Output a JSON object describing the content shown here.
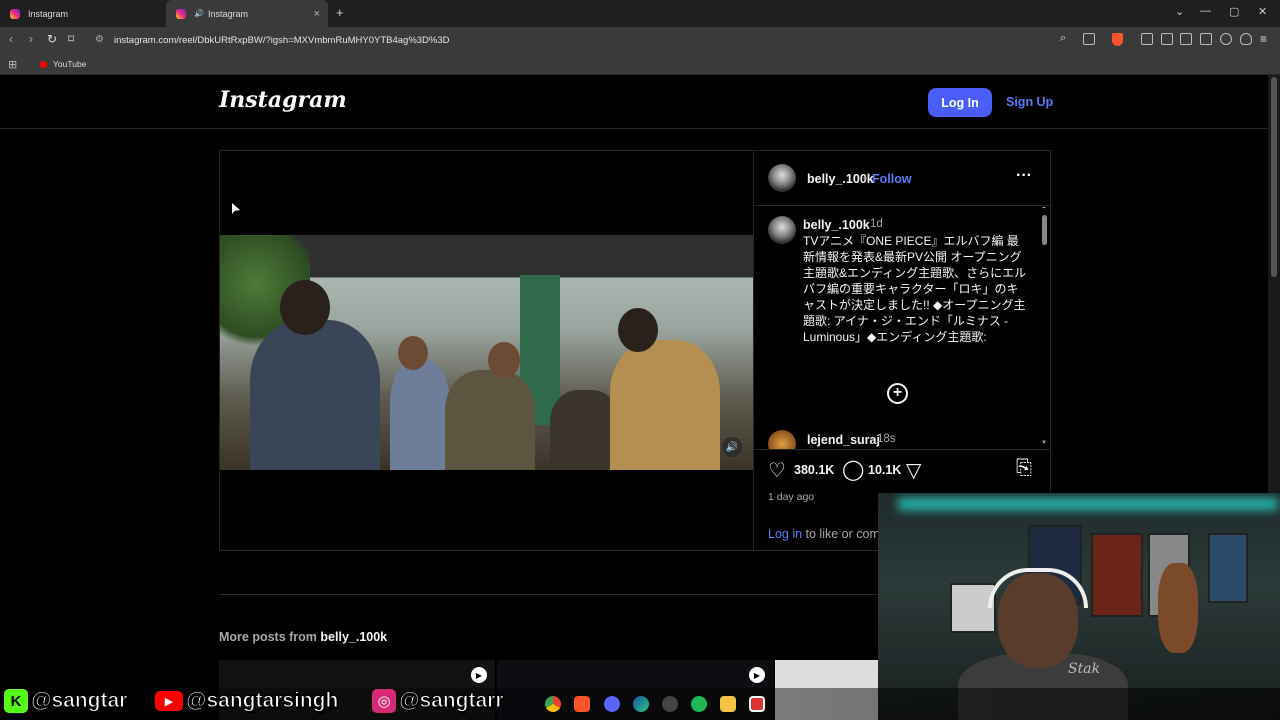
{
  "browser": {
    "tabs": [
      {
        "label": "Instagram"
      },
      {
        "label": "Instagram"
      }
    ],
    "new_tab": "+",
    "url": "instagram.com/reel/DbkURtRxpBW/?igsh=MXVmbmRuMHY0YTB4ag%3D%3D",
    "bookmarks": [
      {
        "label": "YouTube"
      }
    ],
    "controls": {
      "minimize": "—",
      "maximize": "▢",
      "close": "✕",
      "dropdown": "⌄"
    }
  },
  "instagram": {
    "logo": "Instagram",
    "login_label": "Log In",
    "signup_label": "Sign Up",
    "post": {
      "username": "belly_.100k",
      "follow_label": "Follow",
      "separator": "•",
      "more": "···",
      "caption_username": "belly_.100k",
      "caption_time": "1d",
      "caption": "TVアニメ『ONE PIECE』エルバフ編 最新情報を発表&最新PV公開 オープニング主題歌&エンディング主題歌、さらにエルバフ編の重要キャラクター「ロキ」のキャストが決定しました!! ◆オープニング主題歌: アイナ・ジ・エンド「ルミナス - Luminous」◆エンディング主題歌:",
      "load_more": "+",
      "comment_username": "lejend_suraj",
      "comment_time": "18s",
      "likes": "380.1K",
      "comments": "10.1K",
      "time_ago": "1 day ago",
      "login_link": "Log in",
      "login_text": " to like or com"
    },
    "more_posts_prefix": "More posts from ",
    "more_posts_user": "belly_.100k"
  },
  "overlay": {
    "socials": [
      {
        "icon": "K",
        "handle": "@sangtar",
        "color": "#53fc18"
      },
      {
        "icon": "▶",
        "handle": "@sangtarsingh",
        "color": "#ff0000"
      },
      {
        "icon": "◎",
        "handle": "@sangtarr",
        "color": "#d62976"
      }
    ],
    "shirt_text": "Stak"
  }
}
